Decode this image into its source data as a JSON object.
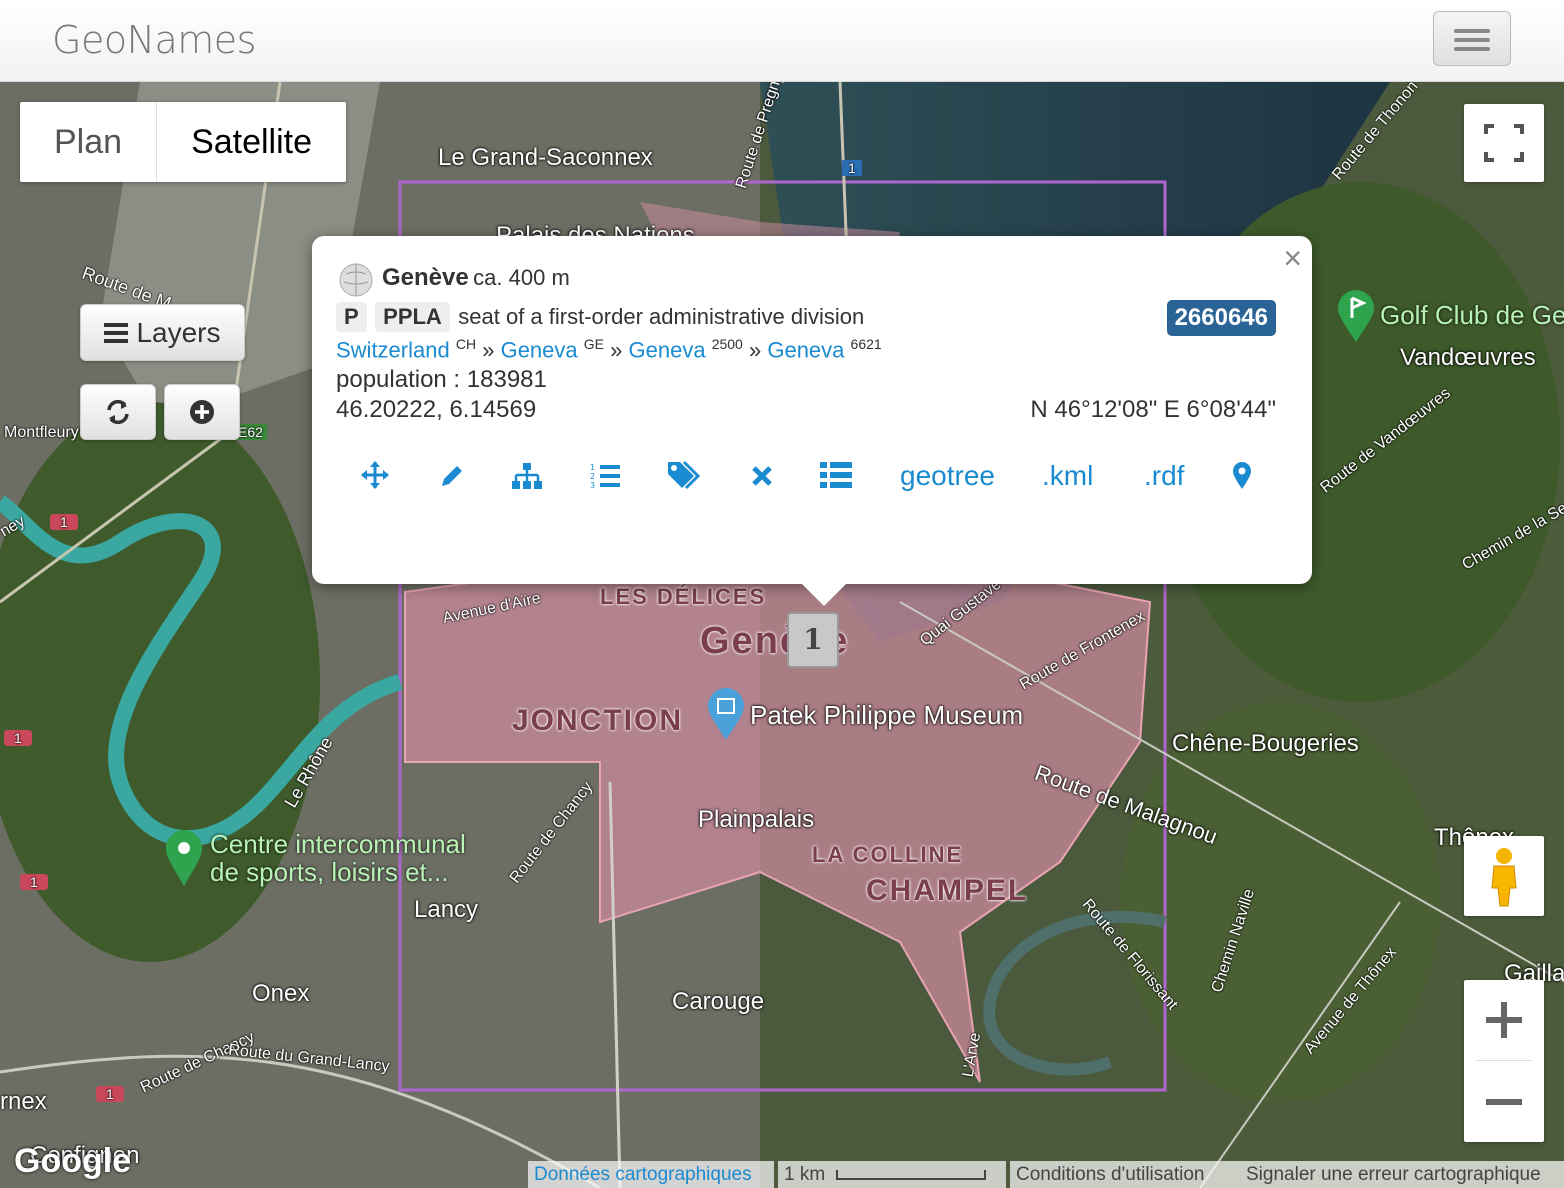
{
  "navbar": {
    "brand": "GeoNames"
  },
  "map": {
    "type_control": {
      "plan": "Plan",
      "satellite": "Satellite"
    },
    "layers_label": "Layers",
    "labels": {
      "grand_saconnex": "Le Grand-Saconnex",
      "palais": "Palais des Nations",
      "golf": "Golf Club de Ge",
      "vandoeuvres": "Vandœuvres",
      "montfleury": "Montfleury",
      "delices": "LES DÉLICES",
      "geneve_city": "Genève",
      "jonction": "JONCTION",
      "patek": "Patek Philippe Museum",
      "chene": "Chêne-Bougeries",
      "plainpalais": "Plainpalais",
      "colline": "LA COLLINE",
      "champel": "CHAMPEL",
      "centre_line1": "Centre intercommunal",
      "centre_line2": "de sports, loisirs et...",
      "lancy": "Lancy",
      "onex": "Onex",
      "carouge": "Carouge",
      "thonex": "Thônex",
      "gaillard": "Gailla",
      "confignon": "Confignon",
      "onex_edge": "rnex",
      "vernier_edge": "ney"
    },
    "roads": {
      "avenue_aire": "Avenue d'Aïre",
      "quai_ador": "Quai Gustave-Ador",
      "route_frontenex": "Route de Frontenex",
      "route_malagnou": "Route de Malagnou",
      "route_chancy": "Route de Chancy",
      "route_chancy2": "Route de Chancy",
      "route_grand_lancy": "Route du Grand-Lancy",
      "route_florissant": "Route de Florissant",
      "chemin_naville": "Chemin Naville",
      "avenue_thonex": "Avenue de Thônex",
      "route_vandoeuvres": "Route de Vandœuvres",
      "chemin_seymaz": "Chemin de la Se",
      "route_thonon": "Route de Thonon",
      "le_rhone": "Le Rhône",
      "arve": "L'Arve",
      "route_pregny": "Route de Pregny",
      "route_meyrin": "Route de M",
      "e62": "E62",
      "route_1": "1"
    },
    "cluster_count": "1",
    "attribution": {
      "map_data": "Données cartographiques",
      "scale": "1 km",
      "terms": "Conditions d'utilisation",
      "report": "Signaler une erreur cartographique",
      "logo": "Google"
    }
  },
  "popup": {
    "name": "Genève",
    "elevation": "ca. 400 m",
    "feature_class": "P",
    "feature_code": "PPLA",
    "feature_desc": "seat of a first-order administrative division",
    "geonameid": "2660646",
    "hierarchy": [
      {
        "name": "Switzerland",
        "code": "CH"
      },
      {
        "name": "Geneva",
        "code": "GE"
      },
      {
        "name": "Geneva",
        "code": "2500"
      },
      {
        "name": "Geneva",
        "code": "6621"
      }
    ],
    "separator": "»",
    "population": "population : 183981",
    "coords_decimal": "46.20222, 6.14569",
    "coords_dms": "N 46°12'08\" E 6°08'44\"",
    "links": {
      "geotree": "geotree",
      "kml": ".kml",
      "rdf": ".rdf"
    },
    "close": "×"
  }
}
